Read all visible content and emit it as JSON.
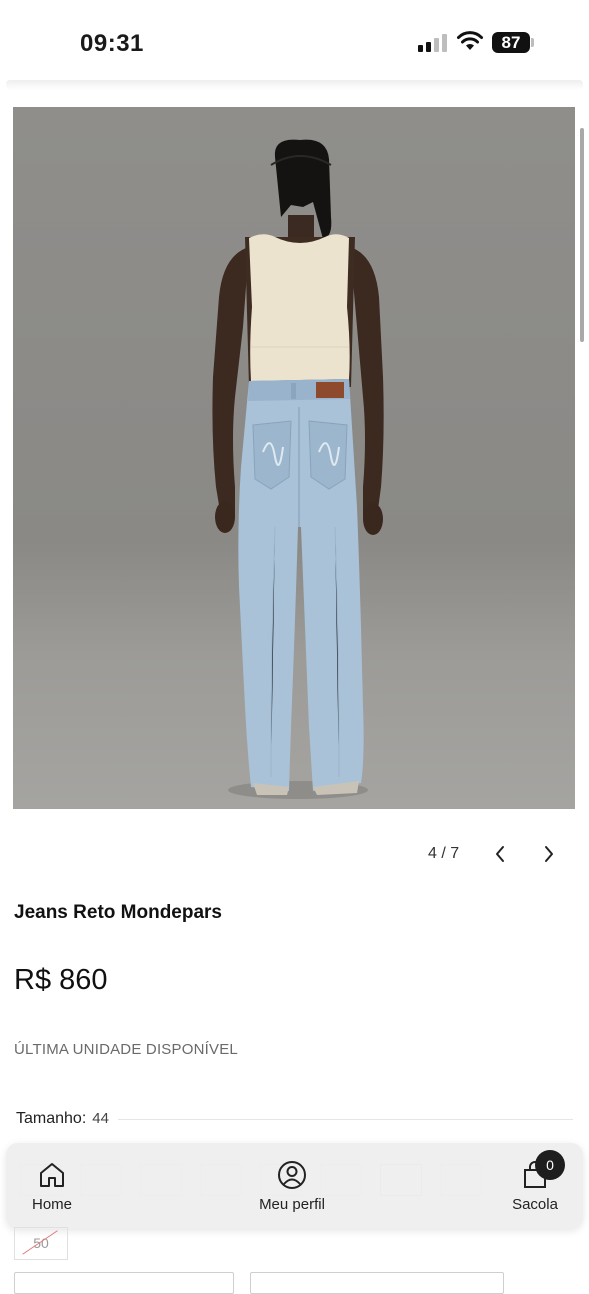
{
  "status_bar": {
    "time": "09:31",
    "battery": "87"
  },
  "gallery": {
    "current": "4",
    "total": "7",
    "counter": "4 / 7"
  },
  "product": {
    "name": "Jeans Reto Mondepars",
    "price": "R$ 860",
    "stock_notice": "ÚLTIMA UNIDADE DISPONÍVEL",
    "size_label": "Tamanho:",
    "size_value": "44",
    "sold_out_size": "50"
  },
  "bottom_nav": {
    "home": "Home",
    "profile": "Meu perfil",
    "bag": "Sacola",
    "bag_count": "0"
  },
  "icons": {
    "prev": "chevron-left-icon",
    "next": "chevron-right-icon",
    "home": "house-icon",
    "profile": "user-circle-icon",
    "bag": "shopping-bag-icon"
  },
  "colors": {
    "badge": "#1e1e1e",
    "jeans": "#a9c2d8",
    "tank_top": "#ece3cf"
  }
}
